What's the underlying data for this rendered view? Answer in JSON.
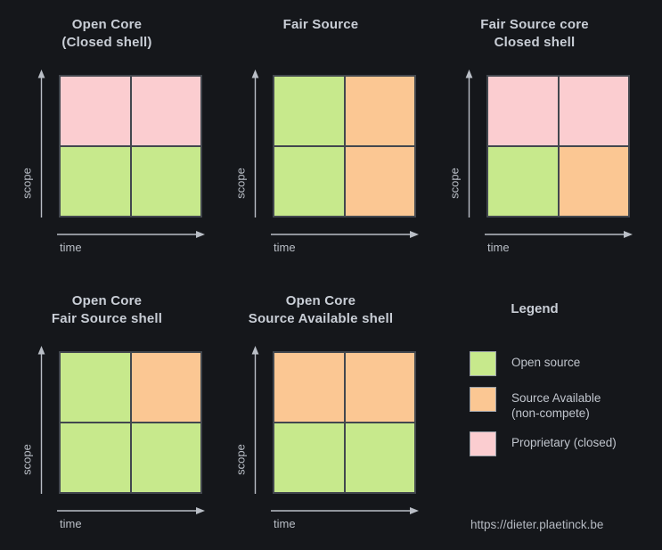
{
  "background_color": "#15171b",
  "colors": {
    "open_source": "#c7e98c",
    "source_available": "#fbc793",
    "proprietary": "#fbcdd0",
    "grid_line": "#42474e",
    "text": "#c9ced6",
    "axis": "#b9bec6"
  },
  "axes": {
    "y_label": "scope",
    "x_label": "time"
  },
  "panels": [
    {
      "id": "open-core-closed-shell",
      "title": "Open Core\n(Closed shell)",
      "cells": [
        "proprietary",
        "proprietary",
        "open_source",
        "open_source"
      ]
    },
    {
      "id": "fair-source",
      "title": "Fair Source",
      "cells": [
        "open_source",
        "source_available",
        "open_source",
        "source_available"
      ]
    },
    {
      "id": "fair-source-core-closed-shell",
      "title": "Fair Source core\nClosed shell",
      "cells": [
        "proprietary",
        "proprietary",
        "open_source",
        "source_available"
      ]
    },
    {
      "id": "open-core-fair-source-shell",
      "title": "Open Core\nFair Source shell",
      "cells": [
        "open_source",
        "source_available",
        "open_source",
        "open_source"
      ]
    },
    {
      "id": "open-core-source-available-shell",
      "title": "Open Core\nSource Available shell",
      "cells": [
        "source_available",
        "source_available",
        "open_source",
        "open_source"
      ]
    }
  ],
  "legend": {
    "title": "Legend",
    "items": [
      {
        "color": "#c7e98c",
        "label": "Open source"
      },
      {
        "color": "#fbc793",
        "label": "Source Available\n(non-compete)"
      },
      {
        "color": "#fbcdd0",
        "label": "Proprietary (closed)"
      }
    ],
    "url": "https://dieter.plaetinck.be"
  }
}
